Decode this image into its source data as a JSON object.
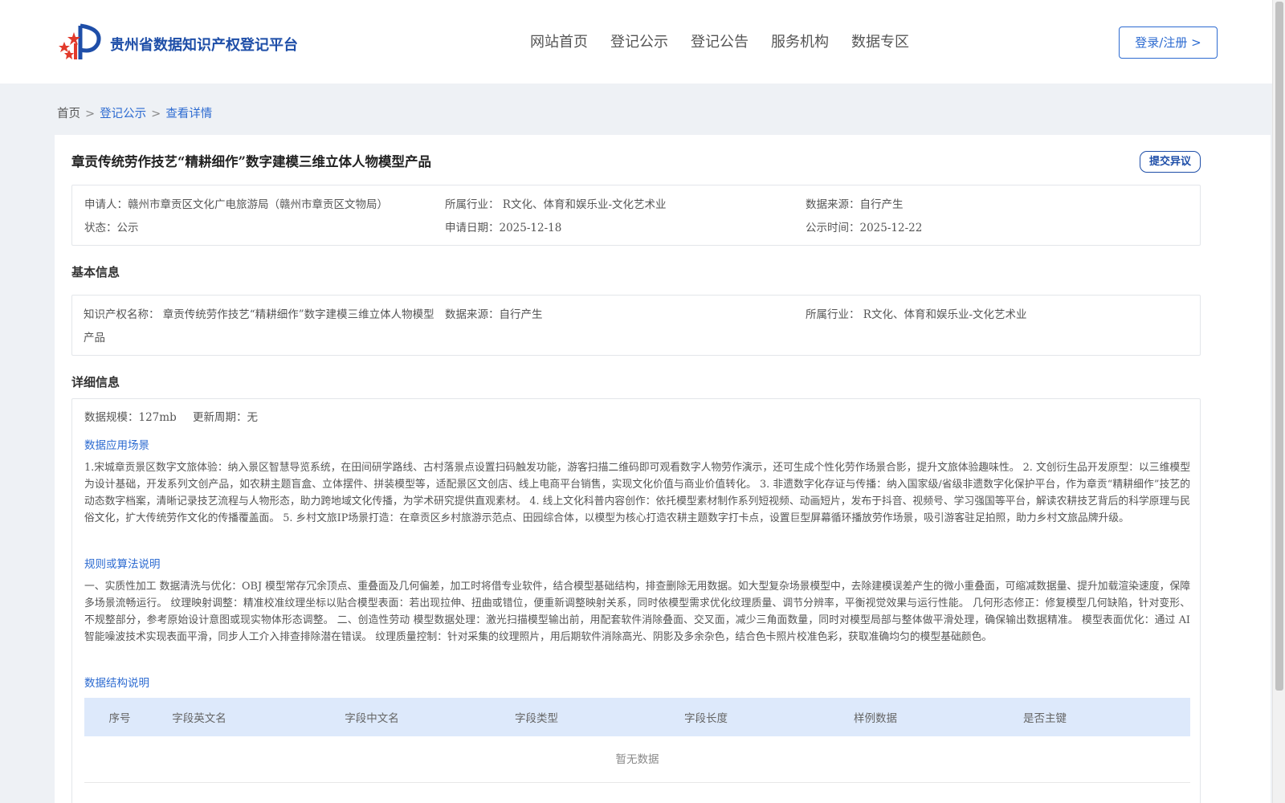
{
  "header": {
    "brand": "贵州省数据知识产权登记平台",
    "nav": [
      "网站首页",
      "登记公示",
      "登记公告",
      "服务机构",
      "数据专区"
    ],
    "login": "登录/注册 >"
  },
  "breadcrumb": {
    "home": "首页",
    "sep": ">",
    "level2": "登记公示",
    "current": "查看详情"
  },
  "record": {
    "title": "章贡传统劳作技艺“精耕细作”数字建模三维立体人物模型产品",
    "objection_button": "提交异议",
    "applicant_label": "申请人：",
    "applicant": "赣州市章贡区文化广电旅游局（赣州市章贡区文物局）",
    "industry_label": "所属行业：",
    "industry": "R文化、体育和娱乐业-文化艺术业",
    "source_label": "数据来源：",
    "source": "自行产生",
    "status_label": "状态：",
    "status": "公示",
    "apply_date_label": "申请日期：",
    "apply_date": "2025-12-18",
    "publish_date_label": "公示时间：",
    "publish_date": "2025-12-22"
  },
  "basic": {
    "section_title": "基本信息",
    "ip_name_label": "知识产权名称：",
    "ip_name_line1": "章贡传统劳作技艺“精耕细作”数字建模三维立体人物模型",
    "ip_name_line2": "产品",
    "source_label": "数据来源：",
    "source": "自行产生",
    "industry_label": "所属行业：",
    "industry": "R文化、体育和娱乐业-文化艺术业"
  },
  "detail": {
    "section_title": "详细信息",
    "scale_label": "数据规模：",
    "scale": "127mb",
    "cycle_label": "更新周期：",
    "cycle": "无",
    "scenario_title": "数据应用场景",
    "scenario_text": "1.宋城章贡景区数字文旅体验：纳入景区智慧导览系统，在田间研学路线、古村落景点设置扫码触发功能，游客扫描二维码即可观看数字人物劳作演示，还可生成个性化劳作场景合影，提升文旅体验趣味性。 2. 文创衍生品开发原型：以三维模型为设计基础，开发系列文创产品，如农耕主题盲盒、立体摆件、拼装模型等，适配景区文创店、线上电商平台销售，实现文化价值与商业价值转化。 3. 非遗数字化存证与传播：纳入国家级/省级非遗数字化保护平台，作为章贡“精耕细作”技艺的动态数字档案，清晰记录技艺流程与人物形态，助力跨地域文化传播，为学术研究提供直观素材。 4. 线上文化科普内容创作：依托模型素材制作系列短视频、动画短片，发布于抖音、视频号、学习强国等平台，解读农耕技艺背后的科学原理与民俗文化，扩大传统劳作文化的传播覆盖面。 5. 乡村文旅IP场景打造：在章贡区乡村旅游示范点、田园综合体，以模型为核心打造农耕主题数字打卡点，设置巨型屏幕循环播放劳作场景，吸引游客驻足拍照，助力乡村文旅品牌升级。",
    "rules_title": "规则或算法说明",
    "rules_text": "一、实质性加工 数据清洗与优化：OBJ 模型常存冗余顶点、重叠面及几何偏差，加工时将借专业软件，结合模型基础结构，排查删除无用数据。如大型复杂场景模型中，去除建模误差产生的微小重叠面，可缩减数据量、提升加载渲染速度，保障多场景流畅运行。 纹理映射调整：精准校准纹理坐标以贴合模型表面：若出现拉伸、扭曲或错位，便重新调整映射关系，同时依模型需求优化纹理质量、调节分辨率，平衡视觉效果与运行性能。 几何形态修正：修复模型几何缺陷，针对变形、不规整部分，参考原始设计意图或现实物体形态调整。 二、创造性劳动 模型数据处理：激光扫描模型输出前，用配套软件消除叠面、交叉面，减少三角面数量，同时对模型局部与整体做平滑处理，确保输出数据精准。 模型表面优化：通过 AI 智能噪波技术实现表面平滑，同步人工介入排查排除潜在错误。 纹理质量控制：针对采集的纹理照片，用后期软件消除高光、阴影及多余杂色，结合色卡照片校准色彩，获取准确均匀的模型基础颜色。",
    "structure_title": "数据结构说明",
    "table_headers": [
      "序号",
      "字段英文名",
      "字段中文名",
      "字段类型",
      "字段长度",
      "样例数据",
      "是否主键"
    ],
    "empty_text": "暂无数据"
  },
  "colors": {
    "brand_blue": "#1e4ea8",
    "link_blue": "#2d6bd1",
    "table_head": "#dde9fb",
    "logo_red": "#e23a2b"
  }
}
